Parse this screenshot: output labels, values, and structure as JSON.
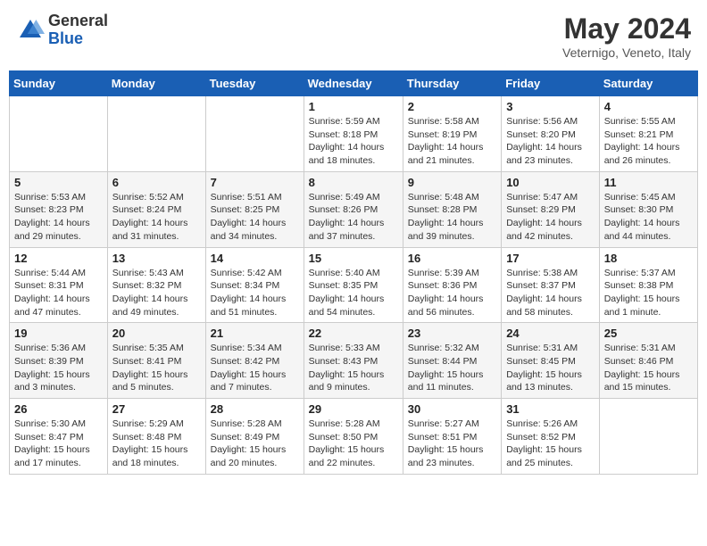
{
  "header": {
    "logo": {
      "general": "General",
      "blue": "Blue"
    },
    "title": "May 2024",
    "location": "Veternigo, Veneto, Italy"
  },
  "weekdays": [
    "Sunday",
    "Monday",
    "Tuesday",
    "Wednesday",
    "Thursday",
    "Friday",
    "Saturday"
  ],
  "weeks": [
    [
      {
        "day": "",
        "info": ""
      },
      {
        "day": "",
        "info": ""
      },
      {
        "day": "",
        "info": ""
      },
      {
        "day": "1",
        "info": "Sunrise: 5:59 AM\nSunset: 8:18 PM\nDaylight: 14 hours and 18 minutes."
      },
      {
        "day": "2",
        "info": "Sunrise: 5:58 AM\nSunset: 8:19 PM\nDaylight: 14 hours and 21 minutes."
      },
      {
        "day": "3",
        "info": "Sunrise: 5:56 AM\nSunset: 8:20 PM\nDaylight: 14 hours and 23 minutes."
      },
      {
        "day": "4",
        "info": "Sunrise: 5:55 AM\nSunset: 8:21 PM\nDaylight: 14 hours and 26 minutes."
      }
    ],
    [
      {
        "day": "5",
        "info": "Sunrise: 5:53 AM\nSunset: 8:23 PM\nDaylight: 14 hours and 29 minutes."
      },
      {
        "day": "6",
        "info": "Sunrise: 5:52 AM\nSunset: 8:24 PM\nDaylight: 14 hours and 31 minutes."
      },
      {
        "day": "7",
        "info": "Sunrise: 5:51 AM\nSunset: 8:25 PM\nDaylight: 14 hours and 34 minutes."
      },
      {
        "day": "8",
        "info": "Sunrise: 5:49 AM\nSunset: 8:26 PM\nDaylight: 14 hours and 37 minutes."
      },
      {
        "day": "9",
        "info": "Sunrise: 5:48 AM\nSunset: 8:28 PM\nDaylight: 14 hours and 39 minutes."
      },
      {
        "day": "10",
        "info": "Sunrise: 5:47 AM\nSunset: 8:29 PM\nDaylight: 14 hours and 42 minutes."
      },
      {
        "day": "11",
        "info": "Sunrise: 5:45 AM\nSunset: 8:30 PM\nDaylight: 14 hours and 44 minutes."
      }
    ],
    [
      {
        "day": "12",
        "info": "Sunrise: 5:44 AM\nSunset: 8:31 PM\nDaylight: 14 hours and 47 minutes."
      },
      {
        "day": "13",
        "info": "Sunrise: 5:43 AM\nSunset: 8:32 PM\nDaylight: 14 hours and 49 minutes."
      },
      {
        "day": "14",
        "info": "Sunrise: 5:42 AM\nSunset: 8:34 PM\nDaylight: 14 hours and 51 minutes."
      },
      {
        "day": "15",
        "info": "Sunrise: 5:40 AM\nSunset: 8:35 PM\nDaylight: 14 hours and 54 minutes."
      },
      {
        "day": "16",
        "info": "Sunrise: 5:39 AM\nSunset: 8:36 PM\nDaylight: 14 hours and 56 minutes."
      },
      {
        "day": "17",
        "info": "Sunrise: 5:38 AM\nSunset: 8:37 PM\nDaylight: 14 hours and 58 minutes."
      },
      {
        "day": "18",
        "info": "Sunrise: 5:37 AM\nSunset: 8:38 PM\nDaylight: 15 hours and 1 minute."
      }
    ],
    [
      {
        "day": "19",
        "info": "Sunrise: 5:36 AM\nSunset: 8:39 PM\nDaylight: 15 hours and 3 minutes."
      },
      {
        "day": "20",
        "info": "Sunrise: 5:35 AM\nSunset: 8:41 PM\nDaylight: 15 hours and 5 minutes."
      },
      {
        "day": "21",
        "info": "Sunrise: 5:34 AM\nSunset: 8:42 PM\nDaylight: 15 hours and 7 minutes."
      },
      {
        "day": "22",
        "info": "Sunrise: 5:33 AM\nSunset: 8:43 PM\nDaylight: 15 hours and 9 minutes."
      },
      {
        "day": "23",
        "info": "Sunrise: 5:32 AM\nSunset: 8:44 PM\nDaylight: 15 hours and 11 minutes."
      },
      {
        "day": "24",
        "info": "Sunrise: 5:31 AM\nSunset: 8:45 PM\nDaylight: 15 hours and 13 minutes."
      },
      {
        "day": "25",
        "info": "Sunrise: 5:31 AM\nSunset: 8:46 PM\nDaylight: 15 hours and 15 minutes."
      }
    ],
    [
      {
        "day": "26",
        "info": "Sunrise: 5:30 AM\nSunset: 8:47 PM\nDaylight: 15 hours and 17 minutes."
      },
      {
        "day": "27",
        "info": "Sunrise: 5:29 AM\nSunset: 8:48 PM\nDaylight: 15 hours and 18 minutes."
      },
      {
        "day": "28",
        "info": "Sunrise: 5:28 AM\nSunset: 8:49 PM\nDaylight: 15 hours and 20 minutes."
      },
      {
        "day": "29",
        "info": "Sunrise: 5:28 AM\nSunset: 8:50 PM\nDaylight: 15 hours and 22 minutes."
      },
      {
        "day": "30",
        "info": "Sunrise: 5:27 AM\nSunset: 8:51 PM\nDaylight: 15 hours and 23 minutes."
      },
      {
        "day": "31",
        "info": "Sunrise: 5:26 AM\nSunset: 8:52 PM\nDaylight: 15 hours and 25 minutes."
      },
      {
        "day": "",
        "info": ""
      }
    ]
  ]
}
